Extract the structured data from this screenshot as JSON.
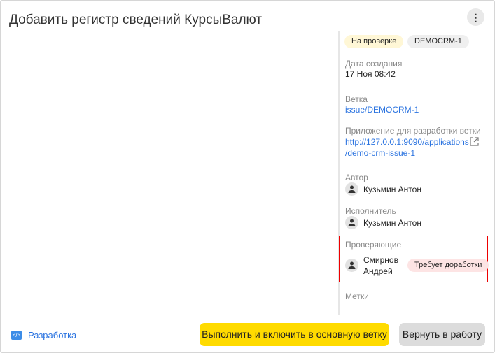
{
  "header": {
    "title": "Добавить регистр сведений КурсыВалют",
    "menu_icon": "more-vertical-icon"
  },
  "status_chip": {
    "label": "На проверке",
    "color": "#fff7d6"
  },
  "issue_chip": {
    "label": "DEMOCRM-1",
    "color": "#efefef"
  },
  "created": {
    "label": "Дата создания",
    "value": "17 Ноя 08:42"
  },
  "branch": {
    "label": "Ветка",
    "value": "issue/DEMOCRM-1"
  },
  "app": {
    "label": "Приложение для разработки ветки",
    "line1": "http://127.0.0.1:9090/applications",
    "line2": "/demo-crm-issue-1"
  },
  "author": {
    "label": "Автор",
    "name": "Кузьмин Антон"
  },
  "assignee": {
    "label": "Исполнитель",
    "name": "Кузьмин Антон"
  },
  "reviewers": {
    "label": "Проверяющие",
    "items": [
      {
        "first": "Смирнов",
        "second": "Андрей",
        "status": "Требует доработки",
        "status_color": "#fde4e4"
      }
    ]
  },
  "tags": {
    "label": "Метки"
  },
  "footer": {
    "dev_link": "Разработка",
    "primary": "Выполнить и включить в основную ветку",
    "secondary": "Вернуть в работу",
    "primary_color": "#ffdb00",
    "secondary_color": "#dcdcdc"
  }
}
